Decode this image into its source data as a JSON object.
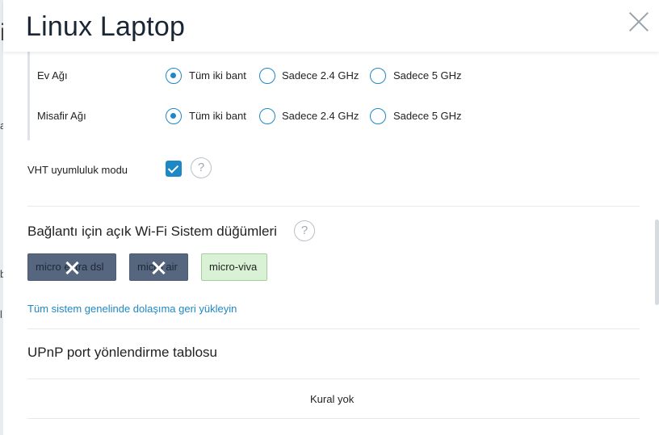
{
  "dialog": {
    "title": "Linux Laptop"
  },
  "background": {
    "letters": [
      "i",
      "a",
      "b",
      "l"
    ]
  },
  "bands": {
    "home": {
      "label": "Ev Ağı",
      "options": [
        "Tüm iki bant",
        "Sadece 2.4 GHz",
        "Sadece 5 GHz"
      ],
      "selected": "Tüm iki bant"
    },
    "guest": {
      "label": "Misafir Ağı",
      "options": [
        "Tüm iki bant",
        "Sadece 2.4 GHz",
        "Sadece 5 GHz"
      ],
      "selected": "Tüm iki bant"
    }
  },
  "vht": {
    "label": "VHT uyumluluk modu",
    "checked": true,
    "help": "?"
  },
  "nodes": {
    "title": "Bağlantı için açık Wi-Fi Sistem düğümleri",
    "help": "?",
    "items": [
      {
        "name": "micro extra dsl",
        "enabled": false
      },
      {
        "name": "micro air",
        "enabled": false
      },
      {
        "name": "micro-viva",
        "enabled": true
      }
    ],
    "reset_link": "Tüm sistem genelinde dolaşıma geri yükleyin"
  },
  "upnp": {
    "title": "UPnP port yönlendirme tablosu",
    "empty_text": "Kural yok"
  },
  "colors": {
    "accent": "#1e88c7",
    "chip_disabled": "#56667f",
    "chip_enabled": "#d9f1d4"
  }
}
